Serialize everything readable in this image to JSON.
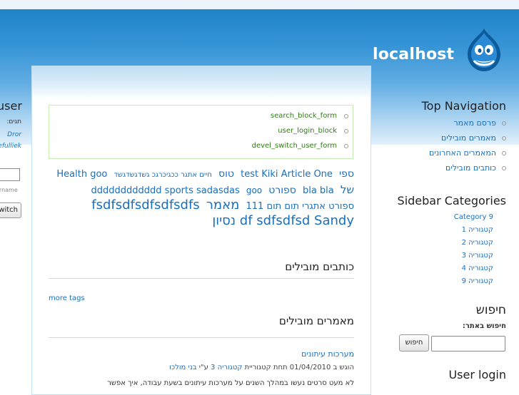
{
  "site": {
    "name": "localhost"
  },
  "main": {
    "blocks": [
      "search_block_form",
      "user_login_block",
      "devel_switch_user_form"
    ],
    "tags": [
      {
        "text": "ספי",
        "size": 14
      },
      {
        "text": "test Kiki Article One",
        "size": 13
      },
      {
        "text": "טוס",
        "size": 14
      },
      {
        "text": "חיים אתגר ככגיכרגכ גשדגשדגשד",
        "size": 10
      },
      {
        "text": "Health goo",
        "size": 13
      },
      {
        "text": "של",
        "size": 15
      },
      {
        "text": "bla bla",
        "size": 13
      },
      {
        "text": "ספורט",
        "size": 14
      },
      {
        "text": "dddddddddddd sports sadasdas",
        "size": 13
      },
      {
        "text": "goo",
        "size": 12
      },
      {
        "text": "ספורט אתגרי תום תום 111",
        "size": 13
      },
      {
        "text": "מאמר",
        "size": 18
      },
      {
        "text": "fsdfsdfsdfsdfsdfs",
        "size": 18
      },
      {
        "text": "df sdfsdfsd Sandy נסיון",
        "size": 18
      }
    ],
    "more_tags": "more tags",
    "sections": {
      "top_authors": "כותבים מובילים",
      "top_articles": "מאמרים מובילים"
    },
    "article": {
      "title": "מערכות עיתונים",
      "meta_prefix": "הוגש ב 01/04/2010 תחת קטגוריית ",
      "meta_category": "קטגוריה 3",
      "meta_by": " ע\"י ",
      "meta_author": "בני מולכו",
      "body": "לא מעט סרטים נעשו במהלך השנים על מערכות עיתונים בשעת עבודה, איך אפשר"
    }
  },
  "left_sidebar": {
    "title": "user",
    "label_1": "תגים:",
    "link_1": "Dror",
    "link_2": "efulliek",
    "username_label": "ername",
    "switch_button": "witch"
  },
  "right_sidebar": {
    "top_nav_title": "Top Navigation",
    "top_nav_items": [
      "פרסם מאמר",
      "מאמרים מובילים",
      "המאמרים האחרונים",
      "כותבים מובילים"
    ],
    "categories_title": "Sidebar Categories",
    "categories": [
      "Category 9",
      "קטגוריה 1",
      "קטגוריה 2",
      "קטגוריה 3",
      "קטגוריה 4",
      "קטגוריה 9"
    ],
    "search_title": "חיפוש",
    "search_label": "חיפוש באתר:",
    "search_button": "חיפוש",
    "user_login_title": "User login"
  },
  "colors": {
    "link": "#1a6fbd",
    "header_blue": "#1f83c9",
    "block_border": "#c6ebb3",
    "block_text": "#2e7d12"
  }
}
